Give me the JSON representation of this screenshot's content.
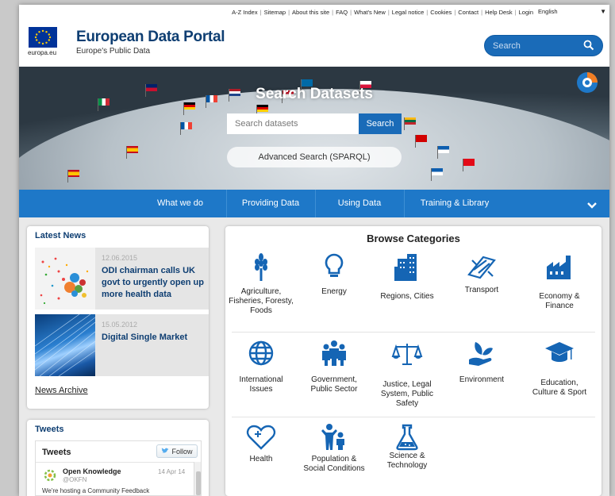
{
  "topbar": {
    "links": [
      "A-Z Index",
      "Sitemap",
      "About this site",
      "FAQ",
      "What's New",
      "Legal notice",
      "Cookies",
      "Contact",
      "Help Desk",
      "Login"
    ],
    "language": "English",
    "language_arrow": "▼"
  },
  "header": {
    "europa_label": "europa.eu",
    "title": "European Data Portal",
    "subtitle": "Europe's Public Data",
    "search_placeholder": "Search"
  },
  "banner": {
    "title": "Search Datasets",
    "search_placeholder": "Search datasets",
    "search_button": "Search",
    "advanced_search": "Advanced Search (SPARQL)"
  },
  "nav": {
    "items": [
      "What we do",
      "Providing Data",
      "Using Data",
      "Training & Library"
    ]
  },
  "news": {
    "heading": "Latest News",
    "items": [
      {
        "date": "12.06.2015",
        "title": "ODI chairman calls UK govt to urgently open up more health data"
      },
      {
        "date": "15.05.2012",
        "title": "Digital Single Market"
      }
    ],
    "archive_link": "News Archive"
  },
  "tweets": {
    "heading": "Tweets",
    "box_title": "Tweets",
    "follow_label": "Follow",
    "items": [
      {
        "name": "Open Knowledge",
        "handle": "@OKFN",
        "date": "14 Apr 14",
        "text": "We're hosting a Community Feedback"
      }
    ]
  },
  "categories": {
    "heading": "Browse Categories",
    "items": [
      {
        "label": "Agriculture, Fisheries, Foresty, Foods",
        "icon": "wheat-icon"
      },
      {
        "label": "Energy",
        "icon": "lightbulb-icon"
      },
      {
        "label": "Regions, Cities",
        "icon": "buildings-icon"
      },
      {
        "label": "Transport",
        "icon": "road-icon"
      },
      {
        "label": "Economy & Finance",
        "icon": "factory-icon"
      },
      {
        "label": "International Issues",
        "icon": "globe-icon"
      },
      {
        "label": "Government, Public Sector",
        "icon": "people-icon"
      },
      {
        "label": "Justice, Legal System, Public Safety",
        "icon": "scales-icon"
      },
      {
        "label": "Environment",
        "icon": "plant-hand-icon"
      },
      {
        "label": "Education, Culture & Sport",
        "icon": "graduation-cap-icon"
      },
      {
        "label": "Health",
        "icon": "heart-icon"
      },
      {
        "label": "Population & Social Conditions",
        "icon": "family-icon"
      },
      {
        "label": "Science & Technology",
        "icon": "flask-icon"
      }
    ]
  },
  "colors": {
    "brand_blue": "#1e78c8",
    "title_navy": "#0e3e72",
    "icon_blue": "#1565b4"
  }
}
